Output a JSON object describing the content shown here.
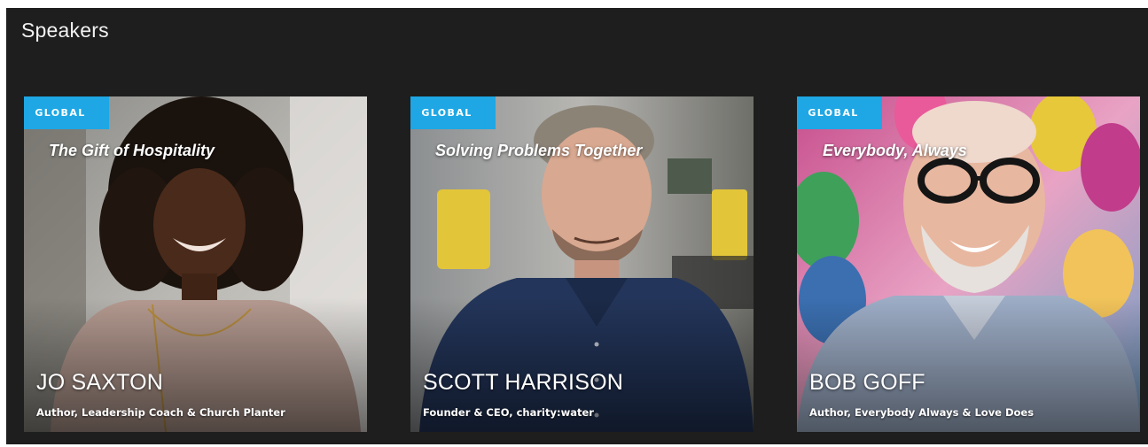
{
  "section": {
    "title": "Speakers"
  },
  "colors": {
    "background": "#1e1e1e",
    "badge": "#1ea7e4",
    "text": "#ffffff"
  },
  "cards": [
    {
      "badge": "GLOBAL",
      "talk_title": "The Gift of Hospitality",
      "name": "JO SAXTON",
      "role": "Author, Leadership Coach & Church Planter"
    },
    {
      "badge": "GLOBAL",
      "talk_title": "Solving Problems Together",
      "name": "SCOTT HARRISON",
      "role": "Founder & CEO, charity:water"
    },
    {
      "badge": "GLOBAL",
      "talk_title": "Everybody, Always",
      "name": "BOB GOFF",
      "role": "Author, Everybody Always & Love Does"
    }
  ]
}
